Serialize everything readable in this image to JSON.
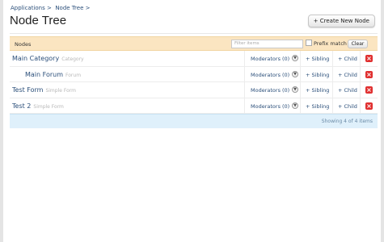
{
  "breadcrumb": {
    "items": [
      "Applications >",
      "Node Tree >"
    ]
  },
  "page": {
    "title": "Node Tree",
    "create_label": "+ Create New Node"
  },
  "table": {
    "header": {
      "label": "Nodes",
      "filter_placeholder": "Filter items",
      "prefix_label": "Prefix match",
      "clear_label": "Clear"
    },
    "rows": [
      {
        "name": "Main Category",
        "type": "Category",
        "moderators": "Moderators (0)",
        "sibling": "+ Sibling",
        "child": "+ Child"
      },
      {
        "name": "Main Forum",
        "type": "Forum",
        "moderators": "Moderators (0)",
        "sibling": "+ Sibling",
        "child": "+ Child"
      },
      {
        "name": "Test Form",
        "type": "Simple Form",
        "moderators": "Moderators (0)",
        "sibling": "+ Sibling",
        "child": "+ Child"
      },
      {
        "name": "Test 2",
        "type": "Simple Form",
        "moderators": "Moderators (0)",
        "sibling": "+ Sibling",
        "child": "+ Child"
      }
    ],
    "footer": {
      "count_text": "Showing 4 of 4 items"
    }
  },
  "colors": {
    "header_bg": "#fbe5c1",
    "footer_bg": "#dff0fb",
    "link": "#2b4f7a",
    "delete": "#e03030"
  },
  "icons": {
    "dropdown": "chevron-down-icon",
    "delete": "delete-icon"
  }
}
